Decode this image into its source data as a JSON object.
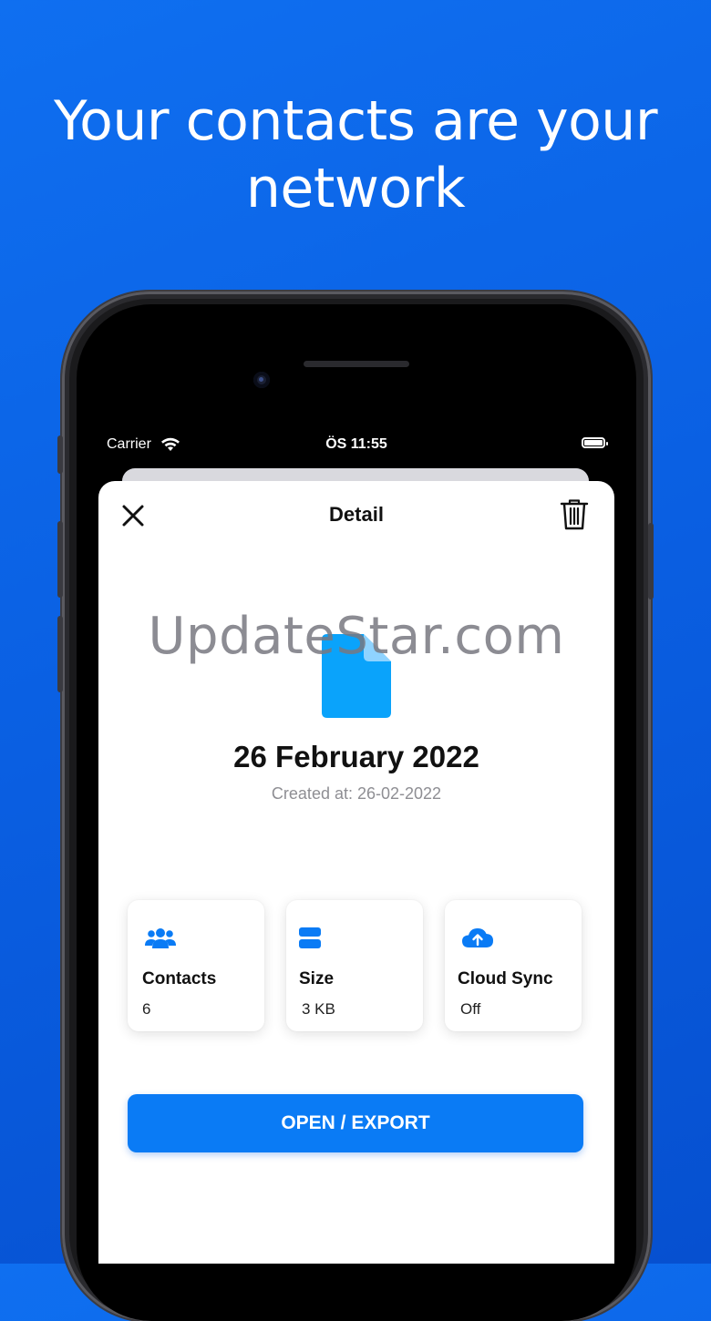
{
  "headline": {
    "line1": "Your contacts are your",
    "line2": "network"
  },
  "status_bar": {
    "carrier": "Carrier",
    "time": "ÖS 11:55"
  },
  "nav": {
    "title": "Detail"
  },
  "watermark": "UpdateStar.com",
  "file": {
    "name": "26 February 2022",
    "created": "Created at: 26-02-2022"
  },
  "cards": [
    {
      "label": "Contacts",
      "value": "6",
      "icon": "users-icon"
    },
    {
      "label": "Size",
      "value": "3 KB",
      "icon": "storage-icon"
    },
    {
      "label": "Cloud Sync",
      "value": "Off",
      "icon": "cloud-upload-icon"
    }
  ],
  "action_button": "OPEN / EXPORT",
  "colors": {
    "accent": "#0a7bf5",
    "background": "#0a5fe2",
    "doc_icon": "#0aa3fb"
  }
}
